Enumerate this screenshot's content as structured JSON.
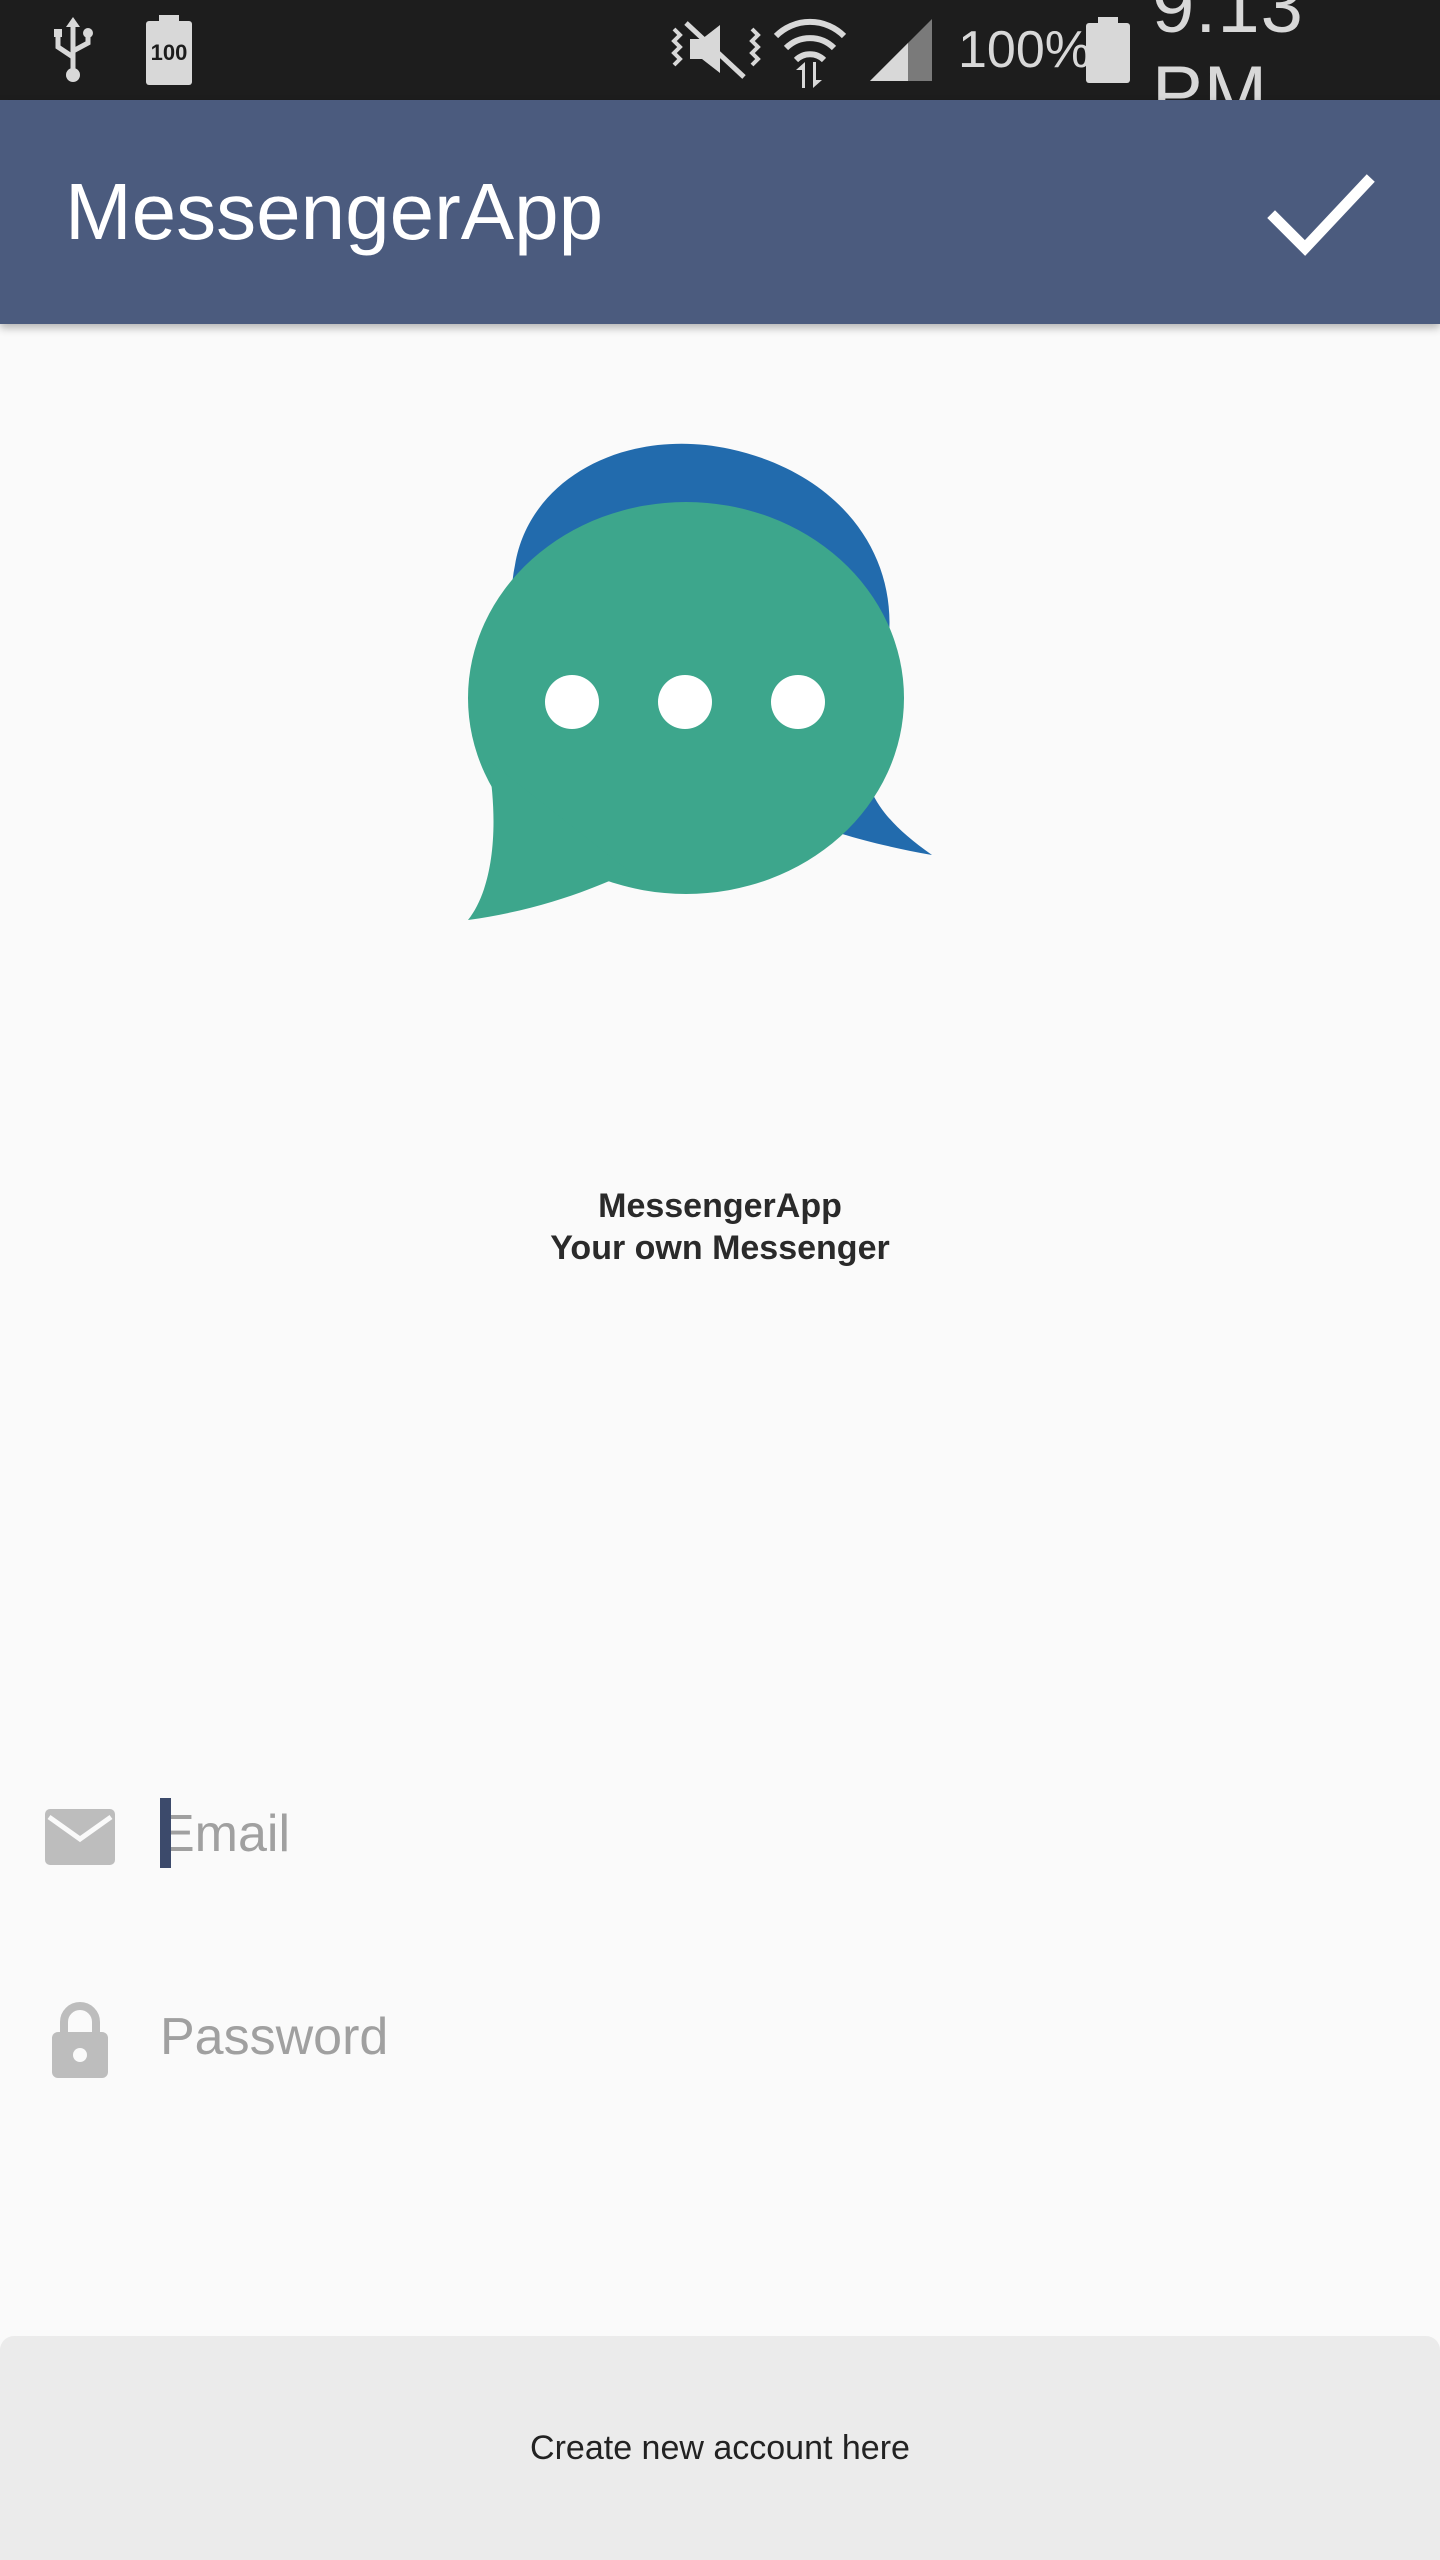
{
  "status_bar": {
    "battery_icon_text": "100",
    "battery_percent": "100%",
    "time": "9:13 PM",
    "icons": [
      "usb-icon",
      "battery-saver-icon",
      "mute-vibrate-icon",
      "wifi-icon",
      "signal-icon",
      "battery-icon"
    ]
  },
  "app_bar": {
    "title": "MessengerApp",
    "confirm_icon": "check-icon"
  },
  "branding": {
    "logo_icon": "chat-bubbles-logo",
    "name": "MessengerApp",
    "slogan": "Your own Messenger",
    "colors": {
      "back_bubble": "#226bad",
      "front_bubble": "#3da68c",
      "app_bar": "#4b5b7e"
    }
  },
  "form": {
    "email": {
      "placeholder": "Email",
      "value": "",
      "icon": "mail-icon"
    },
    "password": {
      "placeholder": "Password",
      "value": "",
      "icon": "lock-icon"
    }
  },
  "footer": {
    "create_account_label": "Create new account here"
  }
}
